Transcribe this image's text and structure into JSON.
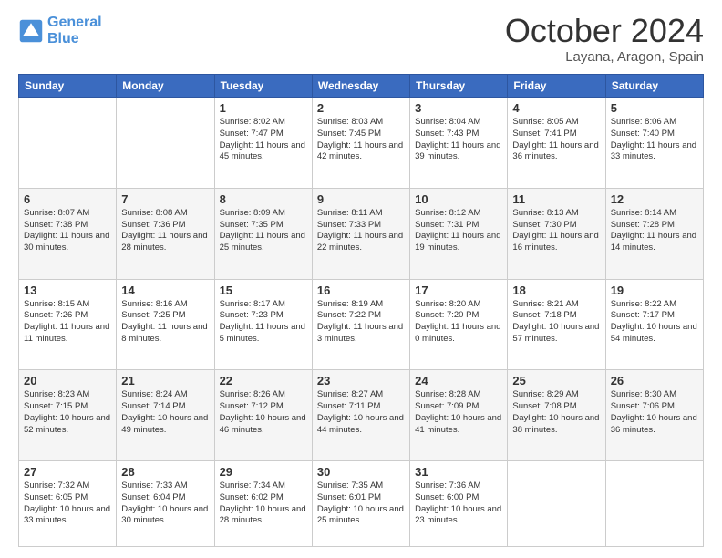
{
  "header": {
    "logo_line1": "General",
    "logo_line2": "Blue",
    "month_title": "October 2024",
    "location": "Layana, Aragon, Spain"
  },
  "days_of_week": [
    "Sunday",
    "Monday",
    "Tuesday",
    "Wednesday",
    "Thursday",
    "Friday",
    "Saturday"
  ],
  "weeks": [
    [
      {
        "day": "",
        "info": ""
      },
      {
        "day": "",
        "info": ""
      },
      {
        "day": "1",
        "info": "Sunrise: 8:02 AM\nSunset: 7:47 PM\nDaylight: 11 hours and 45 minutes."
      },
      {
        "day": "2",
        "info": "Sunrise: 8:03 AM\nSunset: 7:45 PM\nDaylight: 11 hours and 42 minutes."
      },
      {
        "day": "3",
        "info": "Sunrise: 8:04 AM\nSunset: 7:43 PM\nDaylight: 11 hours and 39 minutes."
      },
      {
        "day": "4",
        "info": "Sunrise: 8:05 AM\nSunset: 7:41 PM\nDaylight: 11 hours and 36 minutes."
      },
      {
        "day": "5",
        "info": "Sunrise: 8:06 AM\nSunset: 7:40 PM\nDaylight: 11 hours and 33 minutes."
      }
    ],
    [
      {
        "day": "6",
        "info": "Sunrise: 8:07 AM\nSunset: 7:38 PM\nDaylight: 11 hours and 30 minutes."
      },
      {
        "day": "7",
        "info": "Sunrise: 8:08 AM\nSunset: 7:36 PM\nDaylight: 11 hours and 28 minutes."
      },
      {
        "day": "8",
        "info": "Sunrise: 8:09 AM\nSunset: 7:35 PM\nDaylight: 11 hours and 25 minutes."
      },
      {
        "day": "9",
        "info": "Sunrise: 8:11 AM\nSunset: 7:33 PM\nDaylight: 11 hours and 22 minutes."
      },
      {
        "day": "10",
        "info": "Sunrise: 8:12 AM\nSunset: 7:31 PM\nDaylight: 11 hours and 19 minutes."
      },
      {
        "day": "11",
        "info": "Sunrise: 8:13 AM\nSunset: 7:30 PM\nDaylight: 11 hours and 16 minutes."
      },
      {
        "day": "12",
        "info": "Sunrise: 8:14 AM\nSunset: 7:28 PM\nDaylight: 11 hours and 14 minutes."
      }
    ],
    [
      {
        "day": "13",
        "info": "Sunrise: 8:15 AM\nSunset: 7:26 PM\nDaylight: 11 hours and 11 minutes."
      },
      {
        "day": "14",
        "info": "Sunrise: 8:16 AM\nSunset: 7:25 PM\nDaylight: 11 hours and 8 minutes."
      },
      {
        "day": "15",
        "info": "Sunrise: 8:17 AM\nSunset: 7:23 PM\nDaylight: 11 hours and 5 minutes."
      },
      {
        "day": "16",
        "info": "Sunrise: 8:19 AM\nSunset: 7:22 PM\nDaylight: 11 hours and 3 minutes."
      },
      {
        "day": "17",
        "info": "Sunrise: 8:20 AM\nSunset: 7:20 PM\nDaylight: 11 hours and 0 minutes."
      },
      {
        "day": "18",
        "info": "Sunrise: 8:21 AM\nSunset: 7:18 PM\nDaylight: 10 hours and 57 minutes."
      },
      {
        "day": "19",
        "info": "Sunrise: 8:22 AM\nSunset: 7:17 PM\nDaylight: 10 hours and 54 minutes."
      }
    ],
    [
      {
        "day": "20",
        "info": "Sunrise: 8:23 AM\nSunset: 7:15 PM\nDaylight: 10 hours and 52 minutes."
      },
      {
        "day": "21",
        "info": "Sunrise: 8:24 AM\nSunset: 7:14 PM\nDaylight: 10 hours and 49 minutes."
      },
      {
        "day": "22",
        "info": "Sunrise: 8:26 AM\nSunset: 7:12 PM\nDaylight: 10 hours and 46 minutes."
      },
      {
        "day": "23",
        "info": "Sunrise: 8:27 AM\nSunset: 7:11 PM\nDaylight: 10 hours and 44 minutes."
      },
      {
        "day": "24",
        "info": "Sunrise: 8:28 AM\nSunset: 7:09 PM\nDaylight: 10 hours and 41 minutes."
      },
      {
        "day": "25",
        "info": "Sunrise: 8:29 AM\nSunset: 7:08 PM\nDaylight: 10 hours and 38 minutes."
      },
      {
        "day": "26",
        "info": "Sunrise: 8:30 AM\nSunset: 7:06 PM\nDaylight: 10 hours and 36 minutes."
      }
    ],
    [
      {
        "day": "27",
        "info": "Sunrise: 7:32 AM\nSunset: 6:05 PM\nDaylight: 10 hours and 33 minutes."
      },
      {
        "day": "28",
        "info": "Sunrise: 7:33 AM\nSunset: 6:04 PM\nDaylight: 10 hours and 30 minutes."
      },
      {
        "day": "29",
        "info": "Sunrise: 7:34 AM\nSunset: 6:02 PM\nDaylight: 10 hours and 28 minutes."
      },
      {
        "day": "30",
        "info": "Sunrise: 7:35 AM\nSunset: 6:01 PM\nDaylight: 10 hours and 25 minutes."
      },
      {
        "day": "31",
        "info": "Sunrise: 7:36 AM\nSunset: 6:00 PM\nDaylight: 10 hours and 23 minutes."
      },
      {
        "day": "",
        "info": ""
      },
      {
        "day": "",
        "info": ""
      }
    ]
  ]
}
